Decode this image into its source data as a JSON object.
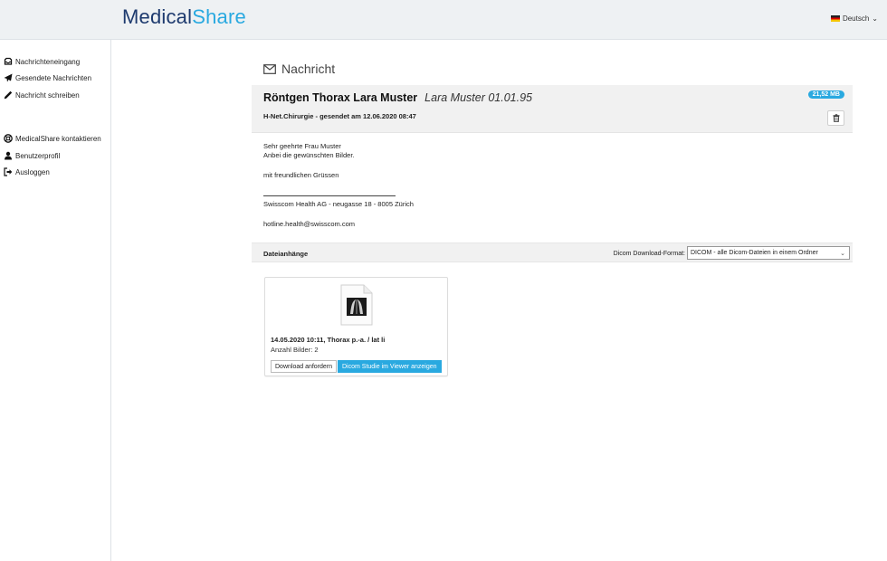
{
  "brand": {
    "part1": "Medical",
    "part2": "Share"
  },
  "language": {
    "label": "Deutsch"
  },
  "sidebar": {
    "items": [
      {
        "label": "Nachrichteneingang",
        "icon": "inbox-icon"
      },
      {
        "label": "Gesendete Nachrichten",
        "icon": "send-icon"
      },
      {
        "label": "Nachricht schreiben",
        "icon": "pencil-icon"
      },
      {
        "label": "MedicalShare kontaktieren",
        "icon": "lifebuoy-icon"
      },
      {
        "label": "Benutzerprofil",
        "icon": "user-icon"
      },
      {
        "label": "Ausloggen",
        "icon": "logout-icon"
      }
    ]
  },
  "page": {
    "title": "Nachricht"
  },
  "message": {
    "subject": "Röntgen Thorax Lara Muster",
    "patient": "Lara Muster 01.01.95",
    "sender": "H-Net.Chirurgie - gesendet am 12.06.2020 08:47",
    "size": "21,52 MB",
    "body": {
      "greeting": "Sehr geehrte Frau Muster",
      "line1": "Anbei die gewünschten Bilder.",
      "closing": "mit freundlichen Grüssen",
      "signature": "Swisscom Health AG - neugasse 18 - 8005 Zürich",
      "email": "hotline.health@swisscom.com"
    }
  },
  "attachments": {
    "title": "Dateianhänge",
    "format_label": "Dicom Download-Format:",
    "format_value": "DICOM - alle Dicom-Dateien in einem Ordner",
    "items": [
      {
        "title": "14.05.2020 10:11, Thorax p.-a. / lat li",
        "count": "Anzahl Bilder: 2",
        "download_label": "Download anfordern",
        "view_label": "Dicom Studie im Viewer anzeigen"
      }
    ]
  },
  "colors": {
    "brand_dark": "#1d3a6e",
    "brand_accent": "#29a9e0"
  }
}
